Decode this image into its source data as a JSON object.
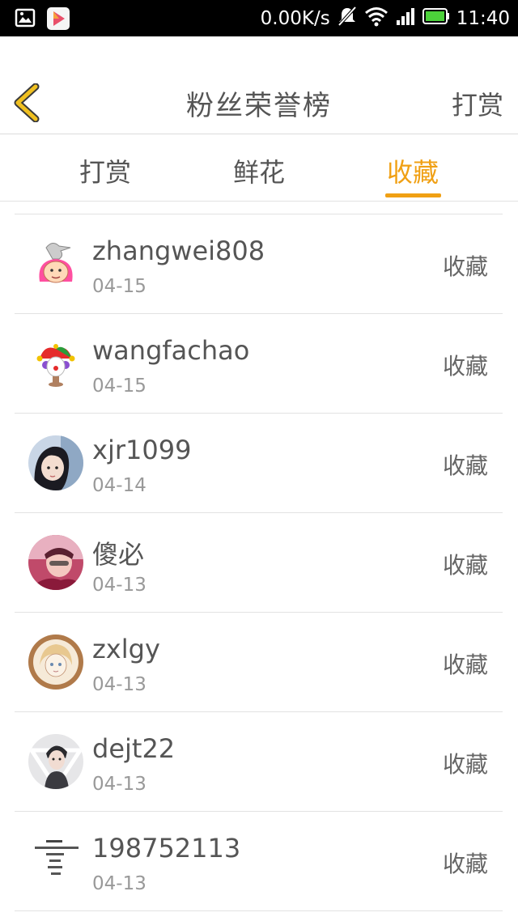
{
  "status_bar": {
    "speed": "0.00K/s",
    "time": "11:40",
    "icons": [
      "gallery-icon",
      "play-store-icon",
      "notification-muted-icon",
      "wifi-icon",
      "signal-icon",
      "battery-icon"
    ],
    "battery_color": "#4cd23a"
  },
  "header": {
    "title": "粉丝荣誉榜",
    "action": "打赏",
    "back_color": "#f0c020"
  },
  "tabs": [
    {
      "label": "打赏"
    },
    {
      "label": "鲜花"
    },
    {
      "label": "收藏",
      "active": true
    }
  ],
  "accent_color": "#f0a014",
  "items": [
    {
      "name": "zhangwei808",
      "date": "04-15",
      "action": "收藏",
      "avatar": "bird-girl-avatar"
    },
    {
      "name": "wangfachao",
      "date": "04-15",
      "action": "收藏",
      "avatar": "jester-avatar"
    },
    {
      "name": "xjr1099",
      "date": "04-14",
      "action": "收藏",
      "avatar": "girl-photo-avatar"
    },
    {
      "name": "傻必",
      "date": "04-13",
      "action": "收藏",
      "avatar": "pink-photo-avatar"
    },
    {
      "name": "zxlgy",
      "date": "04-13",
      "action": "收藏",
      "avatar": "sketch-avatar"
    },
    {
      "name": "dejt22",
      "date": "04-13",
      "action": "收藏",
      "avatar": "boy-photo-avatar"
    },
    {
      "name": "198752113",
      "date": "04-13",
      "action": "收藏",
      "avatar": "text-image-avatar"
    }
  ]
}
